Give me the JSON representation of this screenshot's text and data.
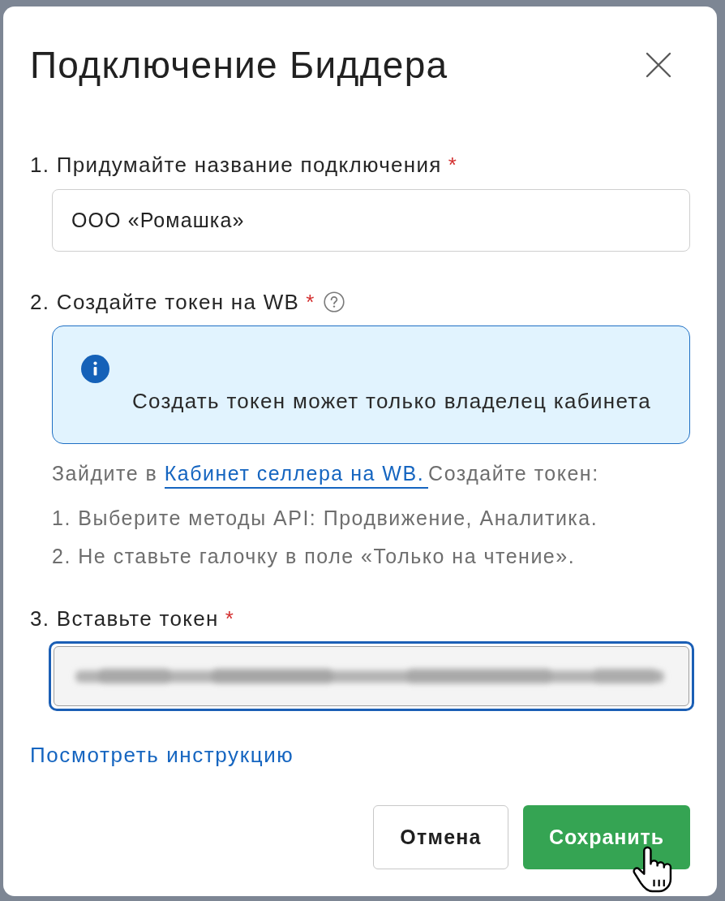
{
  "dialog": {
    "title": "Подключение Биддера"
  },
  "name_field": {
    "label": "1. Придумайте название подключения",
    "required_mark": "*",
    "value": "ООО «Ромашка»"
  },
  "token_section": {
    "label": "2. Создайте токен на WB",
    "required_mark": "*"
  },
  "info_alert": {
    "text": "Создать токен может только владелец кабинета"
  },
  "instructions": {
    "before": "Зайдите в",
    "link": "Кабинет селлера на WB.",
    "after": "Создайте токен:",
    "steps": [
      "1. Выберите методы API: Продвижение, Аналитика.",
      "2. Не ставьте галочку в поле «Только на чтение»."
    ]
  },
  "token_field": {
    "label": "3. Вставьте токен",
    "required_mark": "*",
    "focused": true,
    "value_blurred": true
  },
  "instruction_link": "Посмотреть инструкцию",
  "buttons": [
    {
      "label": "Отмена",
      "kind": "secondary"
    },
    {
      "label": "Сохранить",
      "kind": "primary"
    }
  ]
}
